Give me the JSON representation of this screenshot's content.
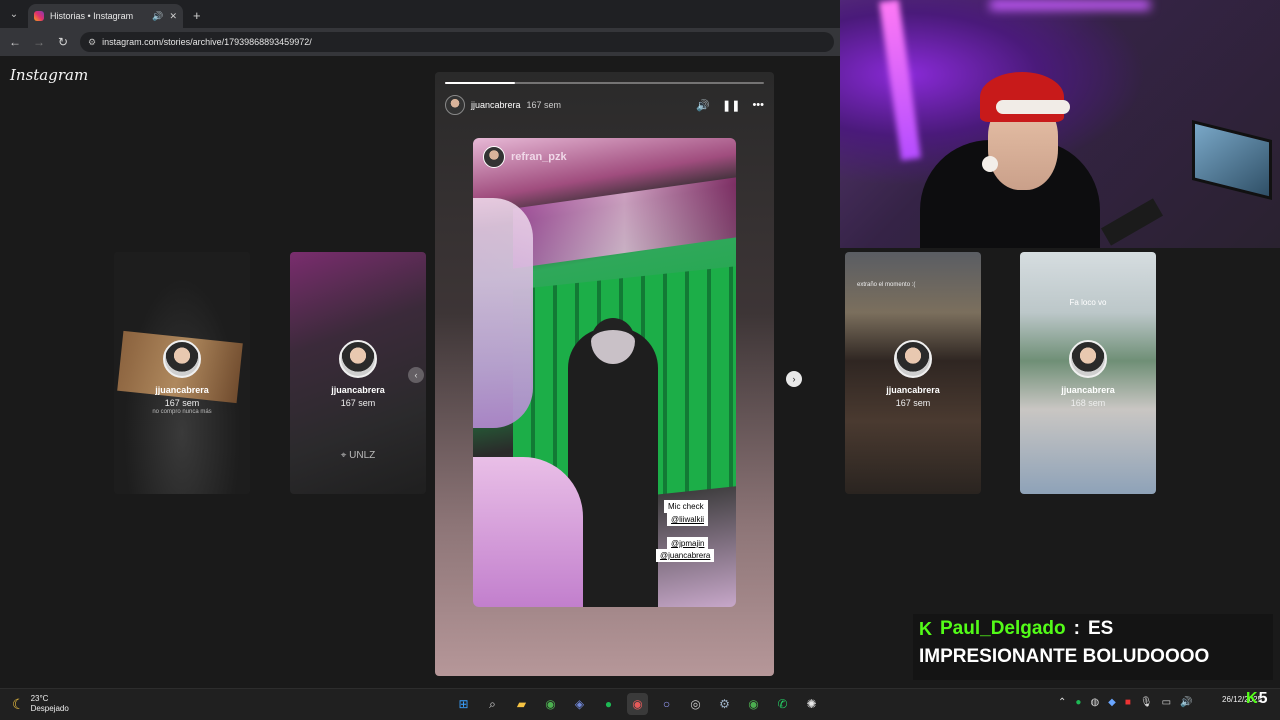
{
  "browser": {
    "tab_title": "Historias • Instagram",
    "new_tab_symbol": "+",
    "url": "instagram.com/stories/archive/17939868893459972/"
  },
  "page": {
    "logo": "Instagram"
  },
  "side_stories": [
    {
      "user": "jjuancabrera",
      "time": "167 sem",
      "caption": "no compro nunca más"
    },
    {
      "user": "jjuancabrera",
      "time": "167 sem",
      "caption": "UNLZ"
    },
    {
      "user": "jjuancabrera",
      "time": "167 sem",
      "caption": "extraño el momento :("
    },
    {
      "user": "jjuancabrera",
      "time": "168 sem",
      "caption": "Fa loco vo"
    }
  ],
  "story": {
    "user": "jjuancabrera",
    "time": "167 sem",
    "progress": 0.22,
    "mention_user": "refran_pzk",
    "stickers": [
      "Mic check",
      "@liiwalkii",
      "@jpmajin",
      "@juancabrera"
    ]
  },
  "chat": {
    "username": "Paul_Delgado",
    "separator": ":",
    "message_part1": "ES",
    "message_part2": "IMPRESIONANTE BOLUDOOOO"
  },
  "taskbar": {
    "temperature": "23°C",
    "condition": "Despejado",
    "date": "26/12/2025",
    "viewer_count": "5"
  },
  "colors": {
    "kick_green": "#53fc18",
    "taskbar_bg": "#202020",
    "page_bg": "#1a1a1a"
  }
}
